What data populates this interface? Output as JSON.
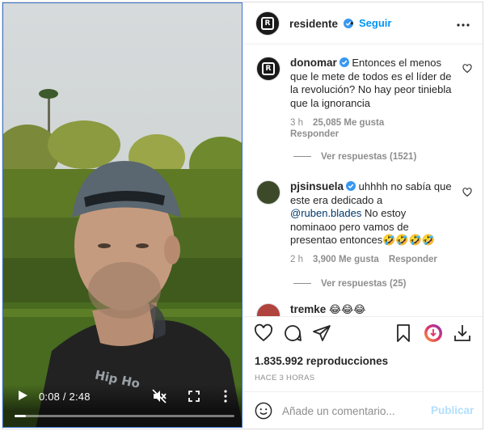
{
  "video": {
    "time": "0:08 / 2:48",
    "progress_fraction": 0.05,
    "icons": [
      "play-icon",
      "mute-icon",
      "fullscreen-icon",
      "more-vertical-icon"
    ]
  },
  "post": {
    "author": "residente",
    "follow_label": "Seguir",
    "dot": "•"
  },
  "comments": [
    {
      "user": "donomar",
      "text": "Entonces el menos que le mete de todos es el líder de la revolución? No hay peor tiniebla que la ignorancia",
      "time": "3 h",
      "likes": "25,085 Me gusta",
      "reply_label": "Responder",
      "replies": "Ver respuestas (1521)"
    },
    {
      "user": "pjsinsuela",
      "text_before": "uhhhh no sabía que este era dedicado a ",
      "mention": "@ruben.blades",
      "text_after": " No estoy nominaoo pero vamos de presentao entonces🤣🤣🤣🤣",
      "time": "2 h",
      "likes": "3,900 Me gusta",
      "reply_label": "Responder",
      "replies": "Ver respuestas (25)"
    },
    {
      "user": "tremke",
      "text": "😂😂😂"
    }
  ],
  "actions": {
    "views": "1.835.992 reproducciones",
    "ago": "HACE 3 HORAS",
    "icons": [
      "heart-icon",
      "comment-icon",
      "share-icon",
      "bookmark-icon",
      "instagram-download-icon",
      "download-icon"
    ]
  },
  "composer": {
    "placeholder": "Añade un comentario...",
    "post_label": "Publicar"
  },
  "colors": {
    "link_blue": "#0095f6",
    "verified_blue": "#3897f0",
    "muted": "#8e8e8e",
    "mention": "#00376b",
    "post_disabled": "#b2dffc"
  }
}
